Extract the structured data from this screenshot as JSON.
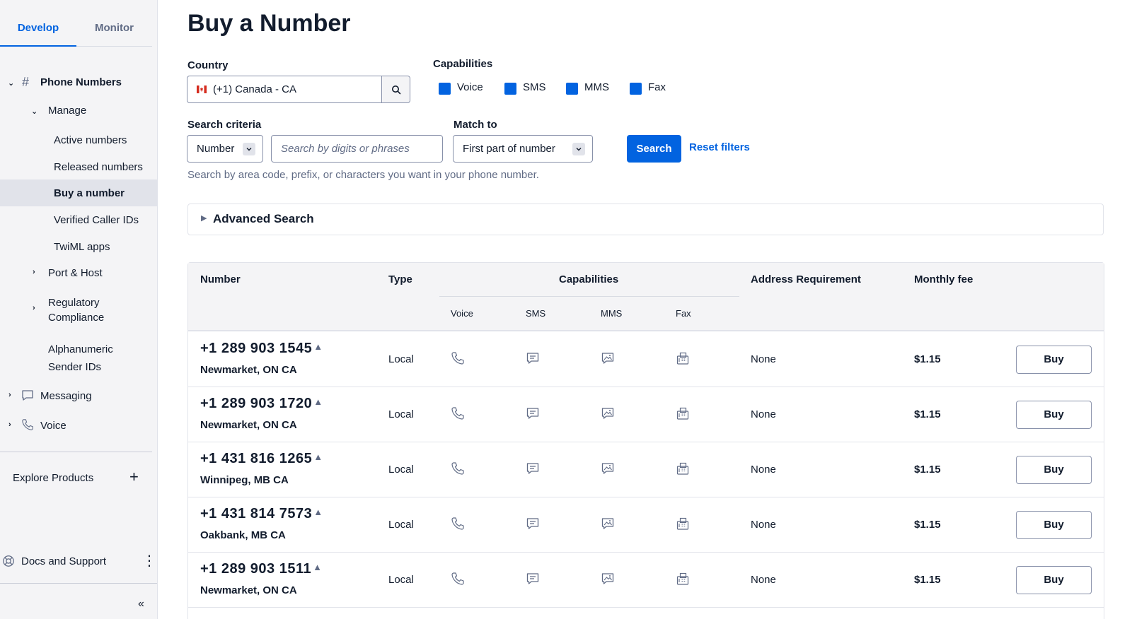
{
  "sidebar": {
    "tabs": [
      {
        "label": "Develop",
        "active": true
      },
      {
        "label": "Monitor",
        "active": false
      }
    ],
    "section_title": "Phone Numbers",
    "manage_label": "Manage",
    "manage_items": [
      "Active numbers",
      "Released numbers",
      "Buy a number",
      "Verified Caller IDs",
      "TwiML apps"
    ],
    "selected_item": "Buy a number",
    "port_host": "Port & Host",
    "regulatory": [
      "Regulatory",
      "Compliance"
    ],
    "alphanumeric": [
      "Alphanumeric",
      "Sender IDs"
    ],
    "messaging": "Messaging",
    "voice": "Voice",
    "explore": "Explore Products",
    "docs": "Docs and Support"
  },
  "main": {
    "title": "Buy a Number",
    "country": {
      "label": "Country",
      "value": "(+1) Canada - CA"
    },
    "capabilities": {
      "label": "Capabilities",
      "items": [
        "Voice",
        "SMS",
        "MMS",
        "Fax"
      ],
      "checked": [
        true,
        true,
        true,
        true
      ]
    },
    "search_criteria": {
      "label": "Search criteria",
      "value": "Number",
      "placeholder": "Search by digits or phrases"
    },
    "match_to": {
      "label": "Match to",
      "value": "First part of number"
    },
    "search_button": "Search",
    "reset_link": "Reset filters",
    "help_text": "Search by area code, prefix, or characters you want in your phone number.",
    "advanced_search": "Advanced Search",
    "brand_color": "#0263e0"
  },
  "table": {
    "headers": {
      "number": "Number",
      "type": "Type",
      "capabilities": "Capabilities",
      "address": "Address Requirement",
      "fee": "Monthly fee"
    },
    "sub_headers": [
      "Voice",
      "SMS",
      "MMS",
      "Fax"
    ],
    "rows": [
      {
        "number": "+1 289 903 1545",
        "location": "Newmarket, ON CA",
        "type": "Local",
        "address": "None",
        "fee": "$1.15",
        "action": "Buy"
      },
      {
        "number": "+1 289 903 1720",
        "location": "Newmarket, ON CA",
        "type": "Local",
        "address": "None",
        "fee": "$1.15",
        "action": "Buy"
      },
      {
        "number": "+1 431 816 1265",
        "location": "Winnipeg, MB CA",
        "type": "Local",
        "address": "None",
        "fee": "$1.15",
        "action": "Buy"
      },
      {
        "number": "+1 431 814 7573",
        "location": "Oakbank, MB CA",
        "type": "Local",
        "address": "None",
        "fee": "$1.15",
        "action": "Buy"
      },
      {
        "number": "+1 289 903 1511",
        "location": "Newmarket, ON CA",
        "type": "Local",
        "address": "None",
        "fee": "$1.15",
        "action": "Buy"
      }
    ]
  }
}
